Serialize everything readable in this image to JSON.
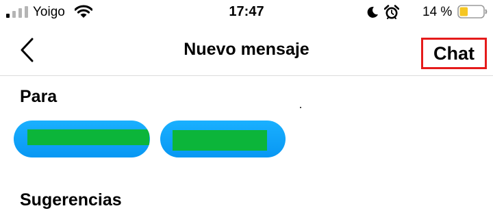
{
  "status_bar": {
    "carrier": "Yoigo",
    "time": "17:47",
    "battery_percent": "14 %",
    "battery_level": 0.14,
    "icons": [
      "signal-icon",
      "wifi-icon",
      "moon-icon",
      "alarm-icon",
      "battery-icon"
    ]
  },
  "nav": {
    "back_icon": "chevron-left-icon",
    "title": "Nuevo mensaje",
    "chat_label": "Chat",
    "highlight_color": "#e51a1a"
  },
  "recipients": {
    "label": "Para",
    "chips": [
      {
        "name": "",
        "redacted": true
      },
      {
        "name": "",
        "redacted": true
      }
    ],
    "chip_color": "#0897f3",
    "redaction_color": "#0cb53a"
  },
  "suggestions": {
    "label": "Sugerencias"
  }
}
